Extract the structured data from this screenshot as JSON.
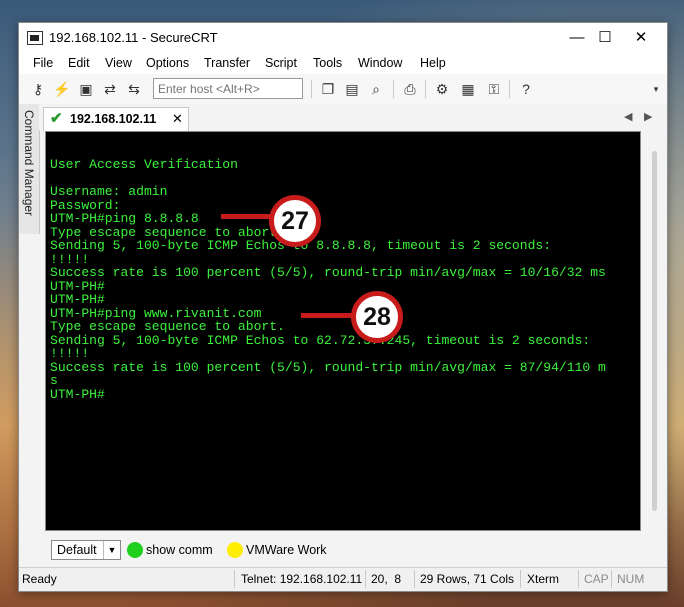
{
  "window": {
    "title": "192.168.102.11 - SecureCRT",
    "controls": {
      "minimize": "—",
      "maximize": "☐",
      "close": "✕"
    }
  },
  "menu": [
    "File",
    "Edit",
    "View",
    "Options",
    "Transfer",
    "Script",
    "Tools",
    "Window",
    "Help"
  ],
  "toolbar": {
    "host_placeholder": "Enter host <Alt+R>",
    "icons": [
      "connect-icon",
      "quick-connect-icon",
      "terminal-icon",
      "reconnect-icon",
      "reconnect-all-icon",
      "copy-icon",
      "paste-icon",
      "find-icon",
      "print-icon",
      "settings-icon",
      "keymap-icon",
      "sftp-icon",
      "help-icon"
    ]
  },
  "side_panel": {
    "label": "Command Manager"
  },
  "tab": {
    "label": "192.168.102.11",
    "close": "✕"
  },
  "terminal": {
    "lines": [
      "User Access Verification",
      "",
      "Username: admin",
      "Password:",
      "UTM-PH#ping 8.8.8.8",
      "Type escape sequence to abort.",
      "Sending 5, 100-byte ICMP Echos to 8.8.8.8, timeout is 2 seconds:",
      "!!!!!",
      "Success rate is 100 percent (5/5), round-trip min/avg/max = 10/16/32 ms",
      "UTM-PH#",
      "UTM-PH#",
      "UTM-PH#ping www.rivanit.com",
      "Type escape sequence to abort.",
      "Sending 5, 100-byte ICMP Echos to 62.72.37.245, timeout is 2 seconds:",
      "!!!!!",
      "Success rate is 100 percent (5/5), round-trip min/avg/max = 87/94/110 m",
      "s",
      "UTM-PH#"
    ],
    "color": "#3cf23c",
    "background": "#000000"
  },
  "callouts": [
    {
      "label": "27"
    },
    {
      "label": "28"
    }
  ],
  "button_bar": {
    "group": "Default",
    "buttons": [
      {
        "label": "show comm",
        "color": "#1fd01f"
      },
      {
        "label": "VMWare Work",
        "color": "#ffee00"
      }
    ]
  },
  "status": {
    "ready": "Ready",
    "connection": "Telnet: 192.168.102.11",
    "cursor": "20,  8",
    "size": "29 Rows, 71 Cols",
    "emulation": "Xterm",
    "cap": "CAP",
    "num": "NUM"
  }
}
